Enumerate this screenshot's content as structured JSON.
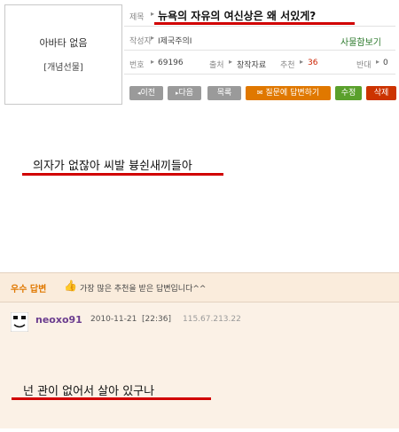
{
  "post": {
    "avatar_text": "아바타 없음",
    "avatar_badge": "[개념선물]",
    "title_label": "제목",
    "title": "뉴욕의 자유의 여신상은 왜 서있게?",
    "author_label": "작성자",
    "author": "I제국주의I",
    "author_link": "사물함보기",
    "number_label": "번호",
    "number": "69196",
    "source_label": "출처",
    "source": "창작자료",
    "recommend_label": "추천",
    "recommend": "36",
    "oppose_label": "반대",
    "oppose": "0",
    "buttons": {
      "prev": "이전",
      "next": "다음",
      "list": "목록",
      "question_answer": "질문에 답변하기",
      "edit": "수정",
      "delete": "삭제"
    },
    "body_text": "의자가 없잖아 씨발 븅쉰새끼들아"
  },
  "answer": {
    "badge": "우수 답변",
    "desc": "가장 많은 추천을 받은 답변입니다^^",
    "user": "neoxo91",
    "date": "2010-11-21",
    "time": "[22:36]",
    "ip": "115.67.213.22",
    "text": "넌 관이 없어서 살아 있구나"
  },
  "colors": {
    "accent_red": "#d10000",
    "recommend_red": "#cc2200",
    "badge_orange": "#e07800",
    "username_purple": "#6b3d8f"
  }
}
